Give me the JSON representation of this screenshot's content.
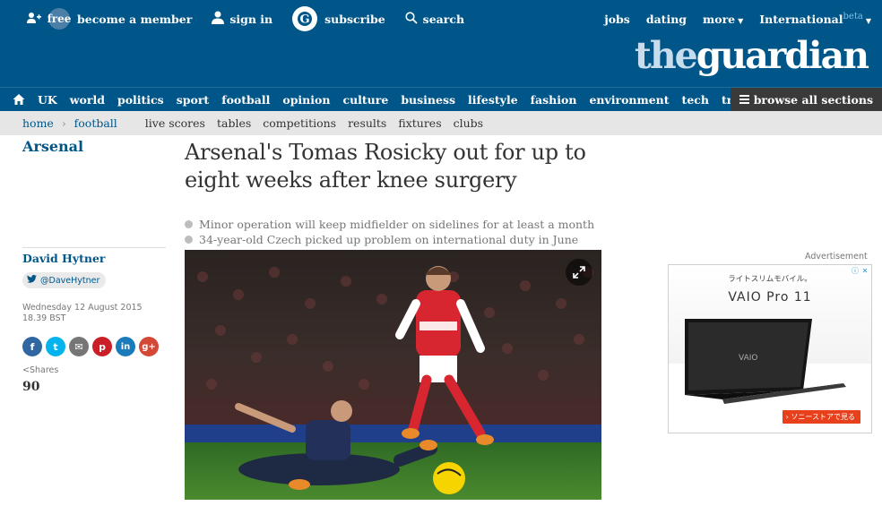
{
  "topbar": {
    "free_label": "free",
    "become_member": "become a member",
    "sign_in": "sign in",
    "subscribe": "subscribe",
    "search": "search",
    "jobs": "jobs",
    "dating": "dating",
    "more": "more",
    "international": "International",
    "beta": "beta"
  },
  "logo": {
    "the": "the",
    "guardian": "guardian"
  },
  "nav": {
    "items": [
      "UK",
      "world",
      "politics",
      "sport",
      "football",
      "opinion",
      "culture",
      "business",
      "lifestyle",
      "fashion",
      "environment",
      "tech",
      "travel"
    ],
    "browse": "browse all sections"
  },
  "subnav": {
    "home": "home",
    "section": "football",
    "items": [
      "live scores",
      "tables",
      "competitions",
      "results",
      "fixtures",
      "clubs"
    ]
  },
  "article": {
    "section": "Arsenal",
    "headline": "Arsenal's Tomas Rosicky out for up to eight weeks after knee surgery",
    "standfirst": [
      "Minor operation will keep midfielder on sidelines for at least a month",
      "34-year-old Czech picked up problem on international duty in June"
    ],
    "author": "David Hytner",
    "twitter": "@DaveHytner",
    "date": "Wednesday 12 August 2015",
    "time": "18.39 BST",
    "shares_label": "Shares",
    "shares_count": "90"
  },
  "share_buttons": [
    {
      "name": "facebook",
      "glyph": "f",
      "color": "#3067a3"
    },
    {
      "name": "twitter",
      "glyph": "t",
      "color": "#03b3ee"
    },
    {
      "name": "email",
      "glyph": "✉",
      "color": "#767676"
    },
    {
      "name": "pinterest",
      "glyph": "p",
      "color": "#cb1f27"
    },
    {
      "name": "linkedin",
      "glyph": "in",
      "color": "#1a7bba"
    },
    {
      "name": "googleplus",
      "glyph": "g+",
      "color": "#d34836"
    }
  ],
  "advert": {
    "label": "Advertisement",
    "tagline_jp": "ライトスリムモバイル。",
    "brand": "VAIO Pro 11",
    "cta": "› ソニーストアで見る"
  },
  "colors": {
    "header_blue": "#005689",
    "subnav_grey": "#e6e6e6",
    "link_blue": "#005689"
  }
}
